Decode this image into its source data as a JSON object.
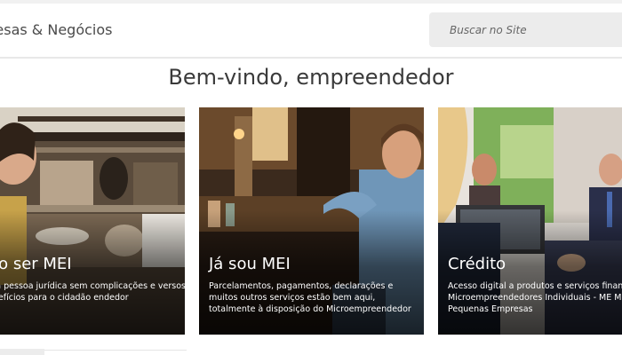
{
  "header": {
    "title": "presas & Negócios",
    "search_placeholder": "Buscar no Site"
  },
  "welcome": "Bem-vindo, empreendedor",
  "cards": [
    {
      "title": "ero ser MEI",
      "text": "uma pessoa jurídica sem complicações e versos benefícios para o cidadão endedor"
    },
    {
      "title": "Já sou MEI",
      "text": "Parcelamentos, pagamentos, declarações e muitos outros serviços estão bem aqui, totalmente à disposição do Microempreendedor"
    },
    {
      "title": "Crédito",
      "text": "Acesso digital a produtos e serviços finance para Microempreendedores Individuais - ME Micro e Pequenas Empresas"
    }
  ],
  "colors": {
    "search_bg": "#ececec",
    "title_text": "#3a3a3a",
    "card_text": "#ffffff"
  }
}
